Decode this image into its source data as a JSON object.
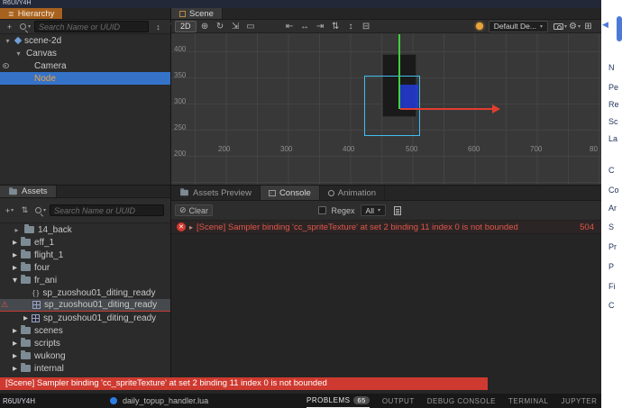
{
  "window": {
    "top_title": "R6UI/Y4H",
    "status_title": "R6UI/Y4H"
  },
  "hierarchy": {
    "tab": "Hierarchy",
    "search_placeholder": "Search Name or UUID",
    "nodes": [
      {
        "label": "scene-2d"
      },
      {
        "label": "Canvas"
      },
      {
        "label": "Camera"
      },
      {
        "label": "Node"
      }
    ]
  },
  "scene": {
    "tab": "Scene",
    "toolbar": {
      "mode": "2D",
      "preset": "Default De..."
    },
    "ruler": {
      "x": [
        "200",
        "300",
        "400",
        "500",
        "600",
        "700",
        "80"
      ],
      "y": [
        "400",
        "350",
        "300",
        "250",
        "200"
      ]
    }
  },
  "assets": {
    "tab": "Assets",
    "search_placeholder": "Search Name or UUID",
    "items": [
      {
        "label": "14_back"
      },
      {
        "label": "eff_1"
      },
      {
        "label": "flight_1"
      },
      {
        "label": "four"
      },
      {
        "label": "fr_ani"
      },
      {
        "label": "sp_zuoshou01_diting_ready"
      },
      {
        "label": "sp_zuoshou01_diting_ready"
      },
      {
        "label": "sp_zuoshou01_diting_ready"
      },
      {
        "label": "scenes"
      },
      {
        "label": "scripts"
      },
      {
        "label": "wukong"
      },
      {
        "label": "internal"
      }
    ]
  },
  "console": {
    "tabs": [
      {
        "label": "Assets Preview"
      },
      {
        "label": "Console"
      },
      {
        "label": "Animation"
      }
    ],
    "toolbar": {
      "clear": "Clear",
      "regex": "Regex",
      "filter": "All"
    },
    "entries": [
      {
        "message": "[Scene] Sampler binding 'cc_spriteTexture' at set 2 binding 11 index 0 is not bounded",
        "count": "504"
      }
    ]
  },
  "toast": {
    "message": "[Scene] Sampler binding 'cc_spriteTexture' at set 2 binding 11 index 0 is not bounded"
  },
  "statusbar": {
    "file": "daily_topup_handler.lua",
    "tabs": [
      {
        "label": "PROBLEMS",
        "badge": "65"
      },
      {
        "label": "OUTPUT"
      },
      {
        "label": "DEBUG CONSOLE"
      },
      {
        "label": "TERMINAL"
      },
      {
        "label": "JUPYTER"
      }
    ]
  },
  "inspector_strip": {
    "fragments": [
      "N",
      "Pe",
      "Re",
      "Sc",
      "La",
      "C",
      "Co",
      "Ar",
      "S",
      "Pr",
      "P",
      "Fi",
      "C"
    ]
  },
  "colors": {
    "accent_orange": "#a8621f",
    "selection_blue": "#3573c9",
    "error_red": "#e2564a",
    "toast_red": "#cf3a30",
    "gizmo_green": "#3fd13f",
    "gizmo_red": "#e23c30",
    "gizmo_blue": "#233cd7",
    "select_cyan": "#3fc0f0"
  }
}
